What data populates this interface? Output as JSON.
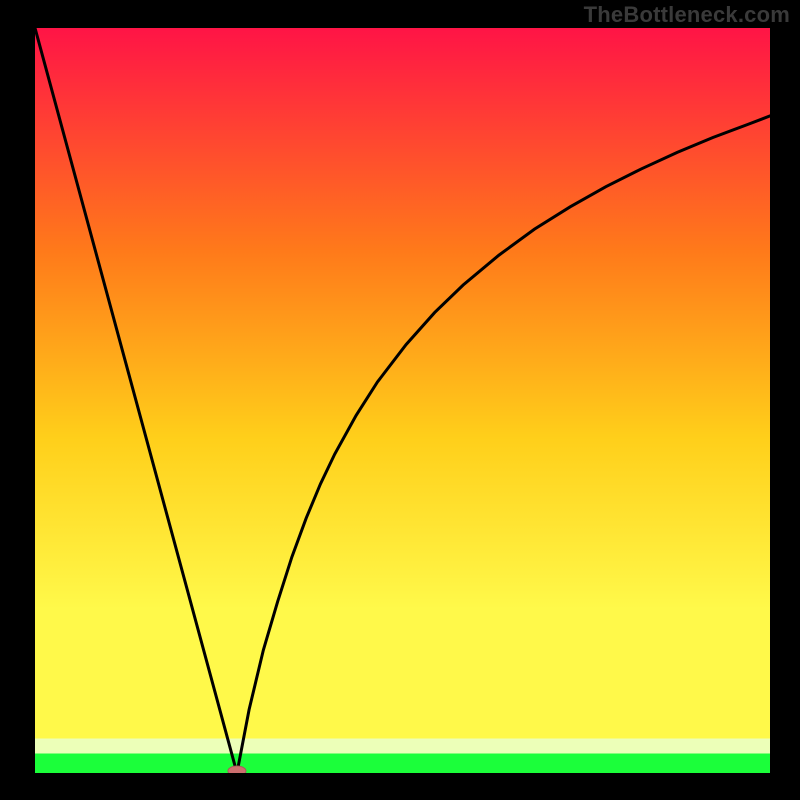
{
  "watermark": "TheBottleneck.com",
  "colors": {
    "frame": "#000000",
    "curve": "#000000",
    "marker_fill": "#cc6f6f",
    "marker_stroke": "#a85a5a",
    "gradient_top": "#ff1446",
    "gradient_mid1": "#ff7a1a",
    "gradient_mid2": "#ffcf1a",
    "gradient_mid3": "#fff94a",
    "gradient_bottom_band": "#ecffb8",
    "gradient_green": "#1bff3a"
  },
  "chart_data": {
    "type": "line",
    "title": "",
    "xlabel": "",
    "ylabel": "",
    "xlim": [
      0,
      103
    ],
    "ylim": [
      0,
      100
    ],
    "left_segment": {
      "x": [
        0,
        28.3
      ],
      "y": [
        100,
        0
      ]
    },
    "right_curve": {
      "x": [
        28.3,
        30,
        32,
        34,
        36,
        38,
        40,
        42,
        45,
        48,
        52,
        56,
        60,
        65,
        70,
        75,
        80,
        85,
        90,
        95,
        100,
        103
      ],
      "y": [
        0,
        8.5,
        16.5,
        23.0,
        29.0,
        34.2,
        38.8,
        42.8,
        48.0,
        52.5,
        57.5,
        61.8,
        65.5,
        69.5,
        73.0,
        76.0,
        78.7,
        81.1,
        83.3,
        85.3,
        87.1,
        88.2
      ]
    },
    "marker": {
      "x": 28.3,
      "y": 0,
      "rx": 9,
      "ry": 5
    },
    "bottom_bands": [
      {
        "color_key": "gradient_bottom_band",
        "y0": 95.4,
        "y1": 97.4
      },
      {
        "color_key": "gradient_green",
        "y0": 97.4,
        "y1": 100
      }
    ]
  }
}
